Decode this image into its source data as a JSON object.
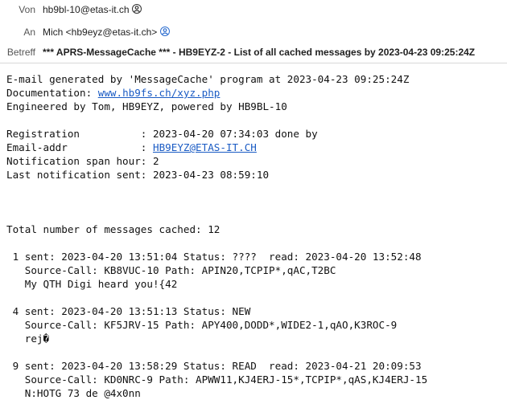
{
  "header": {
    "from_label": "Von",
    "from_value": "hb9bl-10@etas-it.ch",
    "to_label": "An",
    "to_value": "Mich <hb9eyz@etas-it.ch>",
    "subject_label": "Betreff",
    "subject_value": "*** APRS-MessageCache *** - HB9EYZ-2 - List of all cached messages by 2023-04-23 09:25:24Z"
  },
  "body": {
    "intro_line1": "E-mail generated by 'MessageCache' program at 2023-04-23 09:25:24Z",
    "doc_prefix": "Documentation: ",
    "doc_link": "www.hb9fs.ch/xyz.php",
    "intro_line3": "Engineered by Tom, HB9EYZ, powered by HB9BL-10",
    "registration": "Registration          : 2023-04-20 07:34:03 done by",
    "email_prefix": "Email-addr            : ",
    "email_link": "HB9EYZ@ETAS-IT.CH",
    "span_hour": "Notification span hour: 2",
    "last_notification": "Last notification sent: 2023-04-23 08:59:10",
    "total": "Total number of messages cached: 12",
    "messages": [
      {
        "line1": " 1 sent: 2023-04-20 13:51:04 Status: ????  read: 2023-04-20 13:52:48",
        "line2": "   Source-Call: KB8VUC-10 Path: APIN20,TCPIP*,qAC,T2BC",
        "line3": "   My QTH Digi heard you!{42"
      },
      {
        "line1": " 4 sent: 2023-04-20 13:51:13 Status: NEW",
        "line2": "   Source-Call: KF5JRV-15 Path: APY400,DODD*,WIDE2-1,qAO,K3ROC-9",
        "line3": "   rej�"
      },
      {
        "line1": " 9 sent: 2023-04-20 13:58:29 Status: READ  read: 2023-04-21 20:09:53",
        "line2": "   Source-Call: KD0NRC-9 Path: APWW11,KJ4ERJ-15*,TCPIP*,qAS,KJ4ERJ-15",
        "line3": "   N:HOTG 73 de @4x0nn"
      }
    ]
  },
  "colors": {
    "link": "#1a5bc4",
    "label": "#555555",
    "text": "#111111"
  }
}
